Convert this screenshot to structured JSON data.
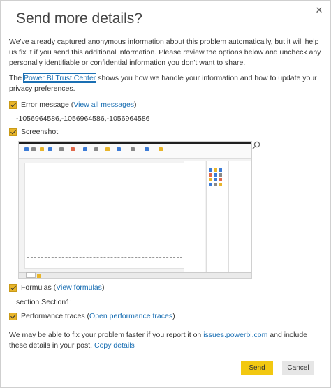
{
  "dialog": {
    "title": "Send more details?",
    "close_glyph": "✕",
    "intro": "We've already captured anonymous information about this problem automatically, but it will help us fix it if you send this additional information. Please review the options below and uncheck any personally identifiable or confidential information you don't want to share.",
    "trust_prefix": "The ",
    "trust_link": "Power BI Trust Center",
    "trust_suffix": " shows you how we handle your information and how to update your privacy preferences."
  },
  "error_message": {
    "label": "Error message",
    "link": "View all messages",
    "value": "-1056964586,-1056964586,-1056964586"
  },
  "screenshot": {
    "label": "Screenshot",
    "zoom_icon": "magnifier-icon"
  },
  "formulas": {
    "label": "Formulas",
    "link": "View formulas",
    "value": "section Section1;"
  },
  "performance": {
    "label": "Performance traces",
    "link": "Open performance traces"
  },
  "footer": {
    "prefix": "We may be able to fix your problem faster if you report it on ",
    "issues_link": "issues.powerbi.com",
    "middle": " and include these details in your post. ",
    "copy_link": "Copy details"
  },
  "buttons": {
    "send": "Send",
    "cancel": "Cancel"
  },
  "colors": {
    "accent": "#f2c811",
    "link": "#1a6fb3"
  }
}
